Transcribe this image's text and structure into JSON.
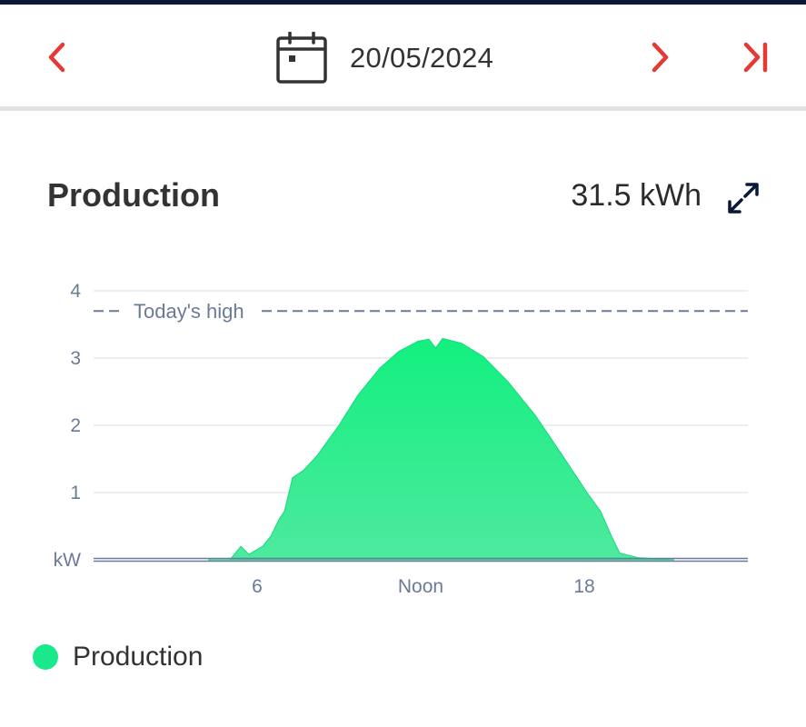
{
  "nav": {
    "date": "20/05/2024"
  },
  "header": {
    "title": "Production",
    "total": "31.5 kWh"
  },
  "icons": {
    "prev": "chevron-left-icon",
    "next": "chevron-right-icon",
    "last": "skip-to-end-icon",
    "calendar": "calendar-icon",
    "expand": "expand-icon"
  },
  "colors": {
    "accent": "#e53935",
    "production": "#19e98a",
    "axis_text": "#6b7a99",
    "dark_navy": "#0b1736"
  },
  "chart_data": {
    "type": "area",
    "ylabel": "kW",
    "ylim": [
      0,
      4
    ],
    "yticks": [
      1,
      2,
      3,
      4
    ],
    "xlim": [
      0,
      24
    ],
    "xticks": [
      {
        "x": 6,
        "label": "6"
      },
      {
        "x": 12,
        "label": "Noon"
      },
      {
        "x": 18,
        "label": "18"
      }
    ],
    "reference_line": {
      "label": "Today's high",
      "value": 3.7
    },
    "grid": true,
    "series": [
      {
        "name": "Production",
        "color": "#19e98a",
        "points": [
          [
            4.2,
            0
          ],
          [
            5.0,
            0
          ],
          [
            5.4,
            0.2
          ],
          [
            5.7,
            0.08
          ],
          [
            6.2,
            0.2
          ],
          [
            6.5,
            0.35
          ],
          [
            6.8,
            0.6
          ],
          [
            7.0,
            0.72
          ],
          [
            7.3,
            1.22
          ],
          [
            7.7,
            1.33
          ],
          [
            8.2,
            1.55
          ],
          [
            9.0,
            2.0
          ],
          [
            9.7,
            2.45
          ],
          [
            10.5,
            2.85
          ],
          [
            11.2,
            3.1
          ],
          [
            11.9,
            3.25
          ],
          [
            12.3,
            3.28
          ],
          [
            12.55,
            3.15
          ],
          [
            12.8,
            3.29
          ],
          [
            13.5,
            3.22
          ],
          [
            14.3,
            3.02
          ],
          [
            15.2,
            2.65
          ],
          [
            16.2,
            2.15
          ],
          [
            17.2,
            1.55
          ],
          [
            18.1,
            1.0
          ],
          [
            18.6,
            0.72
          ],
          [
            19.0,
            0.35
          ],
          [
            19.3,
            0.1
          ],
          [
            20.0,
            0.03
          ],
          [
            21.3,
            0
          ]
        ]
      }
    ]
  },
  "legend": {
    "items": [
      {
        "label": "Production",
        "color": "#19e98a"
      }
    ]
  }
}
